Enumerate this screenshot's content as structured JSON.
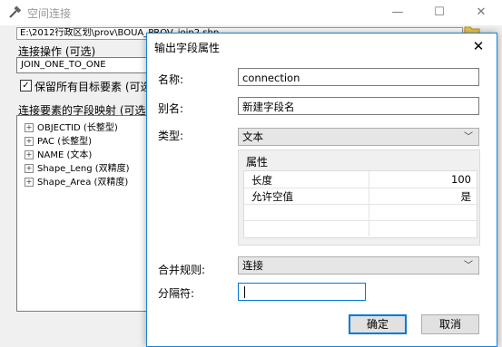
{
  "background_window": {
    "title": "空间连接",
    "path_value": "E:\\2012行政区划\\prov\\BOUA_PROV_join2.shp",
    "join_operation_label": "连接操作 (可选)",
    "join_operation_value": "JOIN_ONE_TO_ONE",
    "keep_all_label": "保留所有目标要素 (可选)",
    "keep_all_checked": "✓",
    "field_map_label": "连接要素的字段映射 (可选)",
    "field_map_items": [
      "OBJECTID (长整型)",
      "PAC (长整型)",
      "NAME (文本)",
      "Shape_Leng (双精度)",
      "Shape_Area (双精度)"
    ],
    "caption_buttons": {
      "minimize": "—",
      "maximize": "☐",
      "close": "✕"
    }
  },
  "dialog": {
    "title": "输出字段属性",
    "close_glyph": "✕",
    "name_label": "名称:",
    "name_value": "connection",
    "alias_label": "别名:",
    "alias_value": "新建字段名",
    "type_label": "类型:",
    "type_value": "文本",
    "properties_title": "属性",
    "properties": [
      {
        "key": "长度",
        "value": "100"
      },
      {
        "key": "允许空值",
        "value": "是"
      }
    ],
    "merge_rule_label": "合并规则:",
    "merge_rule_value": "连接",
    "delimiter_label": "分隔符:",
    "delimiter_value": "",
    "ok_label": "确定",
    "cancel_label": "取消"
  },
  "colors": {
    "accent": "#1883d7",
    "background": "#f0f0f0"
  }
}
